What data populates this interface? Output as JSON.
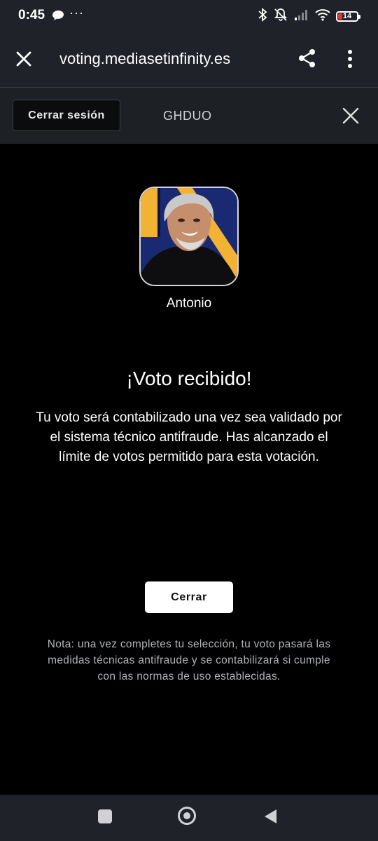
{
  "status_bar": {
    "time": "0:45",
    "more": "···",
    "battery_level": "14",
    "battery_color": "#e0343a",
    "icons": [
      "chat-bubble-icon",
      "bluetooth-icon",
      "mute-icon",
      "signal-icon",
      "wifi-icon",
      "battery-icon"
    ]
  },
  "browser": {
    "url": "voting.mediasetinfinity.es",
    "icons": [
      "close-icon",
      "share-icon",
      "more-vert-icon"
    ]
  },
  "session": {
    "logout_label": "Cerrar sesión",
    "code": "GHDUO"
  },
  "candidate": {
    "name": "Antonio"
  },
  "result": {
    "title": "¡Voto recibido!",
    "message": "Tu voto será contabilizado una vez sea validado por el sistema técnico antifraude. Has alcanzado el límite de votos permitido para esta votación.",
    "close_label": "Cerrar",
    "note": "Nota: una vez completes tu selección, tu voto pasará las medidas técnicas antifraude y se contabilizará si cumple con las normas de uso establecidas."
  },
  "colors": {
    "background": "#000000",
    "bar": "#1f2228",
    "avatar_blue": "#1a2a72",
    "avatar_yellow": "#f2b233"
  }
}
